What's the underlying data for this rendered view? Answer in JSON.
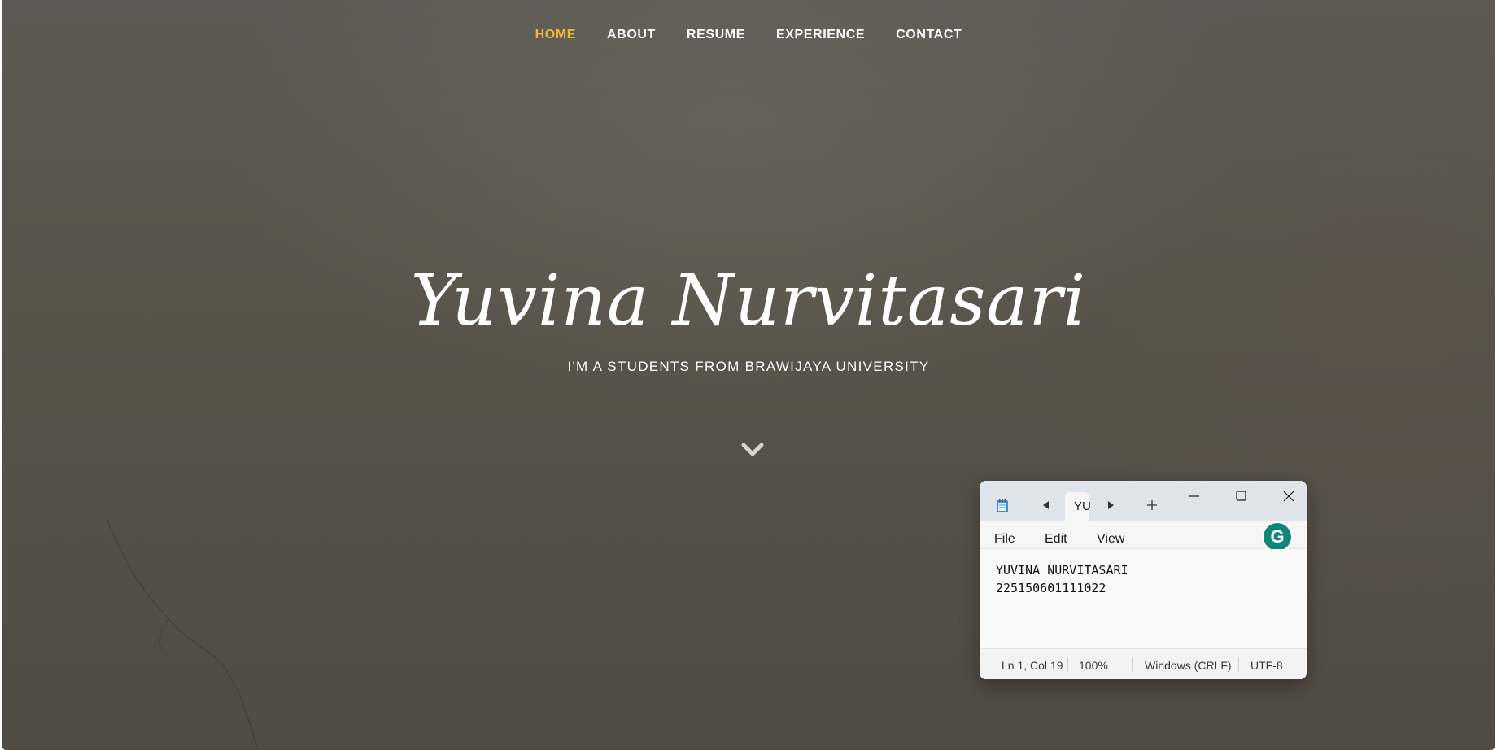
{
  "nav": {
    "items": [
      {
        "label": "HOME"
      },
      {
        "label": "ABOUT"
      },
      {
        "label": "RESUME"
      },
      {
        "label": "EXPERIENCE"
      },
      {
        "label": "CONTACT"
      }
    ],
    "active_color": "#f0b53a"
  },
  "hero": {
    "title": "Yuvina Nurvitasari",
    "subtitle": "I'M A STUDENTS FROM BRAWIJAYA UNIVERSITY",
    "scroll_icon": "chevron-down-icon"
  },
  "notepad": {
    "tab_label": "YU",
    "menu": [
      "File",
      "Edit",
      "View"
    ],
    "content_lines": [
      "YUVINA NURVITASARI",
      "225150601111022"
    ],
    "status": {
      "position": "Ln 1, Col 19",
      "zoom": "100%",
      "line_ending": "Windows (CRLF)",
      "encoding": "UTF-8"
    },
    "grammarly_letter": "G",
    "grammarly_color": "#11857a",
    "icons": [
      "notepad-app-icon",
      "tab-prev-icon",
      "tab-next-icon",
      "new-tab-icon",
      "minimize-icon",
      "maximize-icon",
      "close-icon",
      "grammarly-icon"
    ]
  }
}
